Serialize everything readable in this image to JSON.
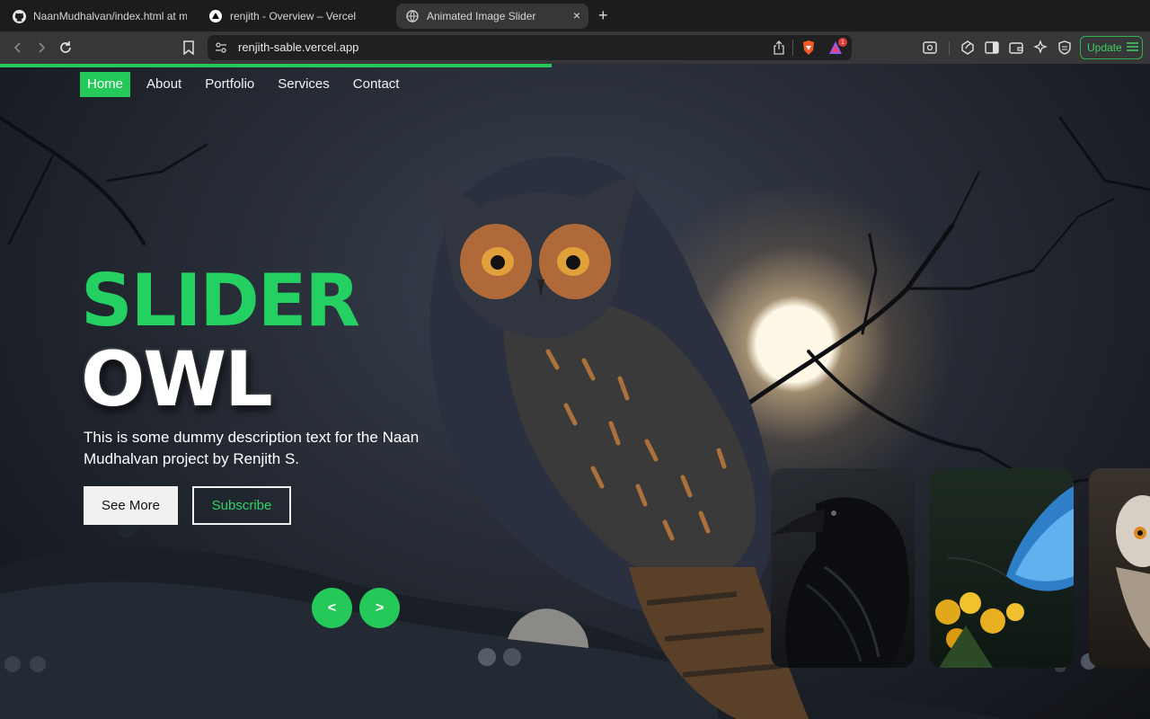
{
  "browser": {
    "tabs": [
      {
        "title": "NaanMudhalvan/index.html at mair",
        "icon": "github-icon"
      },
      {
        "title": "renjith - Overview – Vercel",
        "icon": "vercel-icon"
      },
      {
        "title": "Animated Image Slider",
        "icon": "globe-icon",
        "active": true
      }
    ],
    "new_tab": "+",
    "close": "×",
    "url": "renjith-sable.vercel.app",
    "update_label": "Update",
    "shield_badge": "1"
  },
  "site": {
    "nav": [
      "Home",
      "About",
      "Portfolio",
      "Services",
      "Contact"
    ],
    "active_nav": "Home",
    "progress_fraction": 0.48,
    "title": "SLIDER",
    "subtitle": "OWL",
    "description": "This is some dummy description text for the Naan Mudhalvan project by Renjith S.",
    "see_more": "See More",
    "subscribe": "Subscribe",
    "prev": "<",
    "next": ">",
    "thumbnails": [
      "crow",
      "butterfly",
      "owl"
    ]
  },
  "colors": {
    "accent": "#24c95a",
    "tab_strip": "#1c1c1e",
    "toolbar": "#37373a"
  }
}
